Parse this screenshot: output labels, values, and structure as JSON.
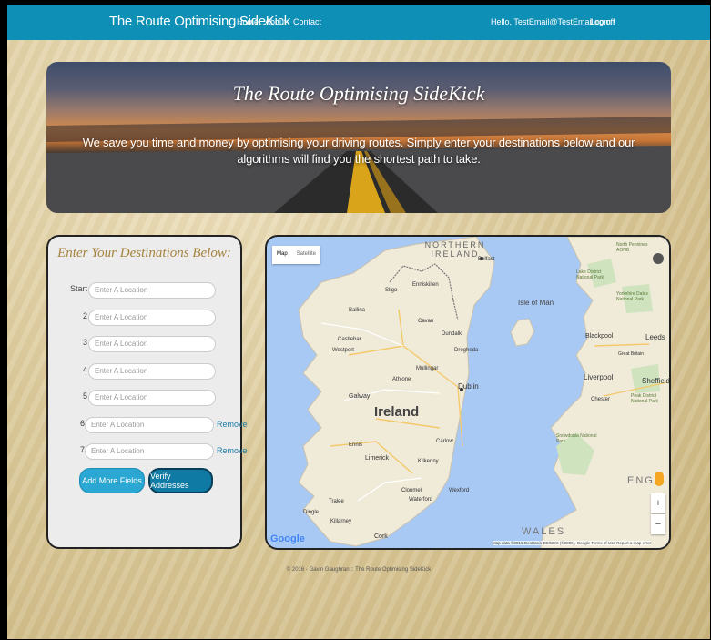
{
  "nav": {
    "brand": "The Route Optimising SideKick",
    "links": [
      "Home",
      "About",
      "Contact"
    ],
    "greeting": "Hello, TestEmail@TestEmail.com !",
    "logoff": "Log off"
  },
  "hero": {
    "title": "The Route Optimising SideKick",
    "text": "We save you time and money by optimising your driving routes. Simply enter your destinations below and our algorithms will find you the shortest path to take."
  },
  "form": {
    "title": "Enter Your Destinations Below:",
    "rows": [
      {
        "label": "Start",
        "placeholder": "Enter A Location"
      },
      {
        "label": "2",
        "placeholder": "Enter A Location"
      },
      {
        "label": "3",
        "placeholder": "Enter A Location"
      },
      {
        "label": "4",
        "placeholder": "Enter A Location"
      },
      {
        "label": "5",
        "placeholder": "Enter A Location"
      },
      {
        "label": "6",
        "placeholder": "Enter A Location",
        "remove": "Remove"
      },
      {
        "label": "7",
        "placeholder": "Enter A Location",
        "remove": "Remove"
      }
    ],
    "add_button": "Add More Fields",
    "verify_button": "Verify Addresses"
  },
  "map": {
    "type_map": "Map",
    "type_satellite": "Satellite",
    "labels": {
      "northern_ireland": "NORTHERN IRELAND",
      "ireland": "Ireland",
      "isle_of_man": "Isle of Man",
      "wales": "WALES",
      "england": "ENGL",
      "belfast": "Belfast",
      "dublin": "Dublin",
      "galway": "Galway",
      "limerick": "Limerick",
      "cork": "Cork",
      "waterford": "Waterford",
      "sligo": "Sligo",
      "leeds": "Leeds",
      "liverpool": "Liverpool",
      "sheffield": "Sheffield",
      "blackpool": "Blackpool",
      "chester": "Chester",
      "dundalk": "Dundalk",
      "drogheda": "Drogheda",
      "athlone": "Athlone",
      "kilkenny": "Kilkenny",
      "wexford": "Wexford",
      "tralee": "Tralee",
      "ennis": "Ennis",
      "mullingar": "Mullingar",
      "castlebar": "Castlebar",
      "ballina": "Ballina",
      "enniskillen": "Enniskillen",
      "cavan": "Cavan",
      "carlow": "Carlow",
      "clonmel": "Clonmel",
      "killarney": "Killarney",
      "westport": "Westport",
      "dingle": "Dingle",
      "snowdonia": "Snowdonia National Park",
      "lake_district": "Lake District National Park",
      "yorkshire_dales": "Yorkshire Dales National Park",
      "peak_district": "Peak District National Park",
      "great_britain": "Great Britain",
      "north_pennines": "North Pennines AONB"
    },
    "google": "Google",
    "attribution": "Map data ©2016 GeoBasis-DE/BKG (©2009), Google   Terms of Use   Report a map error",
    "zoom_in": "+",
    "zoom_out": "−"
  },
  "footer": "© 2016 - Gavin Gaughran :: The Route Optimising SideKick",
  "colors": {
    "navbar": "#0e8fb5",
    "add_button": "#2ba7d3",
    "verify_button": "#0f7aa3",
    "title_gold": "#a6823e"
  }
}
